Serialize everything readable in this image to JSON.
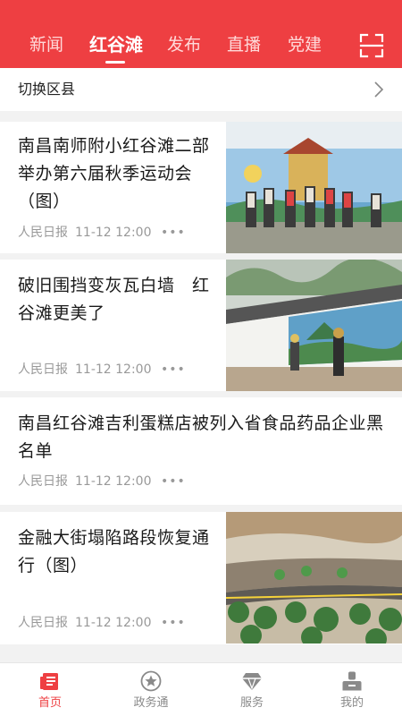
{
  "header": {
    "tabs": [
      "新闻",
      "红谷滩",
      "发布",
      "直播",
      "党建"
    ],
    "active_tab": "红谷滩",
    "scan_icon": "scan-icon",
    "colors": {
      "background": "#ee3f42",
      "active_text": "#ffffff",
      "inactive_text": "#ffd9d9"
    }
  },
  "district": {
    "label": "切换区县"
  },
  "articles": [
    {
      "title": "南昌南师附小红谷滩二部举办第六届秋季运动会（图）",
      "source": "人民日报",
      "time": "11-12 12:00",
      "more": "•••"
    },
    {
      "title": "破旧围挡变灰瓦白墙　红谷滩更美了",
      "source": "人民日报",
      "time": "11-12 12:00",
      "more": "•••"
    },
    {
      "title": "南昌红谷滩吉利蛋糕店被列入省食品药品企业黑名单",
      "source": "人民日报",
      "time": "11-12 12:00",
      "more": "•••"
    },
    {
      "title": "金融大街塌陷路段恢复通行（图）",
      "source": "人民日报",
      "time": "11-12 12:00",
      "more": "•••"
    }
  ],
  "bottom_nav": [
    {
      "label": "首页",
      "icon": "news-icon",
      "active": true
    },
    {
      "label": "政务通",
      "icon": "star-icon",
      "active": false
    },
    {
      "label": "服务",
      "icon": "diamond-icon",
      "active": false
    },
    {
      "label": "我的",
      "icon": "user-icon",
      "active": false
    }
  ],
  "accent_color": "#ee3f42"
}
